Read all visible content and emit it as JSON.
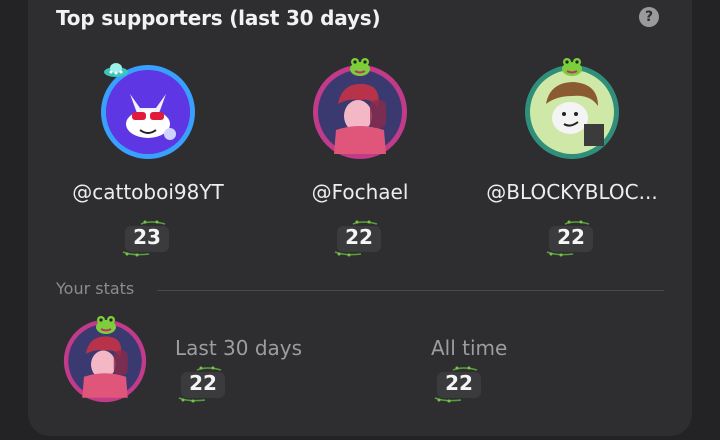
{
  "header": {
    "title": "Top supporters (last 30 days)",
    "help_icon": "help-circle-icon",
    "help_glyph": "?"
  },
  "supporters": [
    {
      "username": "@cattoboi98YT",
      "count": "23",
      "badge": "ufo-badge-icon"
    },
    {
      "username": "@Fochael",
      "count": "22",
      "badge": "frog-badge-icon"
    },
    {
      "username": "@BLOCKYBLOC...",
      "count": "22",
      "badge": "frog-badge-icon"
    }
  ],
  "your_stats": {
    "label": "Your stats",
    "last_30_label": "Last 30 days",
    "last_30_value": "22",
    "all_time_label": "All time",
    "all_time_value": "22"
  },
  "colors": {
    "card_bg": "#2e2e30",
    "page_bg": "#232325",
    "ring_blue": "#3aa0ff",
    "ring_pink": "#c23b8a",
    "ring_teal": "#2f8f7a",
    "vine_green": "#5aa03a"
  }
}
